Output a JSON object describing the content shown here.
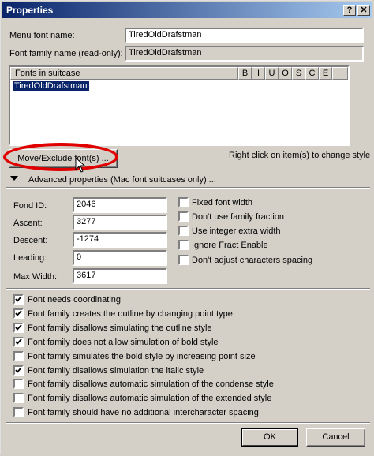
{
  "window": {
    "title": "Properties",
    "help_label": "?",
    "close_label": "✕"
  },
  "menu_font": {
    "label": "Menu font name:",
    "value": "TiredOldDrafstman"
  },
  "family_name": {
    "label": "Font family name (read-only):",
    "value": "TiredOldDrafstman"
  },
  "fonts_list": {
    "header": "Fonts in suitcase",
    "columns": [
      "B",
      "I",
      "U",
      "O",
      "S",
      "C",
      "E"
    ],
    "items": [
      "TiredOldDrafstman"
    ]
  },
  "move_exclude_button": "Move/Exclude font(s) ...",
  "right_click_hint": "Right click on item(s) to change style",
  "advanced_label": "Advanced properties (Mac font suitcases only) ...",
  "fields": [
    {
      "label": "Fond ID:",
      "value": "2046"
    },
    {
      "label": "Ascent:",
      "value": "3277"
    },
    {
      "label": "Descent:",
      "value": "-1274"
    },
    {
      "label": "Leading:",
      "value": "0"
    },
    {
      "label": "Max Width:",
      "value": "3617"
    }
  ],
  "side_options": [
    {
      "label": "Fixed font width",
      "checked": false
    },
    {
      "label": "Don't use family fraction",
      "checked": false
    },
    {
      "label": "Use integer extra width",
      "checked": false
    },
    {
      "label": "Ignore Fract Enable",
      "checked": false
    },
    {
      "label": "Don't adjust characters spacing",
      "checked": false
    }
  ],
  "flags": [
    {
      "label": "Font needs coordinating",
      "checked": true
    },
    {
      "label": "Font family creates the outline by changing point type",
      "checked": true
    },
    {
      "label": "Font family disallows simulating the outline style",
      "checked": true
    },
    {
      "label": "Font family does not allow simulation of bold style",
      "checked": true
    },
    {
      "label": "Font family simulates the bold style by increasing point size",
      "checked": false
    },
    {
      "label": "Font family disallows simulation the italic style",
      "checked": true
    },
    {
      "label": "Font family disallows automatic simulation of the condense style",
      "checked": false
    },
    {
      "label": "Font family disallows automatic simulation of the extended style",
      "checked": false
    },
    {
      "label": "Font family should have no additional intercharacter spacing",
      "checked": false
    }
  ],
  "ok_label": "OK",
  "cancel_label": "Cancel",
  "colors": {
    "titlebar_start": "#0a246a",
    "selection": "#0a246a",
    "highlight_ring": "#e00000"
  }
}
